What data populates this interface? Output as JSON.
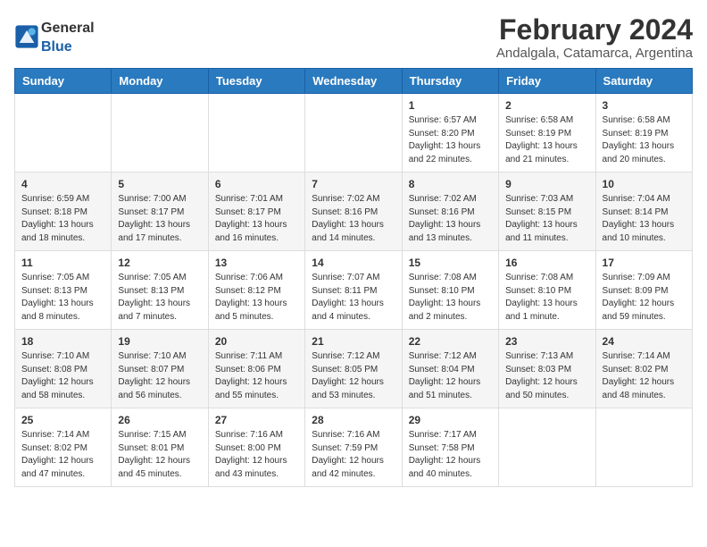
{
  "header": {
    "logo_general": "General",
    "logo_blue": "Blue",
    "title": "February 2024",
    "subtitle": "Andalgala, Catamarca, Argentina"
  },
  "calendar": {
    "days_of_week": [
      "Sunday",
      "Monday",
      "Tuesday",
      "Wednesday",
      "Thursday",
      "Friday",
      "Saturday"
    ],
    "weeks": [
      [
        {
          "day": "",
          "info": ""
        },
        {
          "day": "",
          "info": ""
        },
        {
          "day": "",
          "info": ""
        },
        {
          "day": "",
          "info": ""
        },
        {
          "day": "1",
          "info": "Sunrise: 6:57 AM\nSunset: 8:20 PM\nDaylight: 13 hours\nand 22 minutes."
        },
        {
          "day": "2",
          "info": "Sunrise: 6:58 AM\nSunset: 8:19 PM\nDaylight: 13 hours\nand 21 minutes."
        },
        {
          "day": "3",
          "info": "Sunrise: 6:58 AM\nSunset: 8:19 PM\nDaylight: 13 hours\nand 20 minutes."
        }
      ],
      [
        {
          "day": "4",
          "info": "Sunrise: 6:59 AM\nSunset: 8:18 PM\nDaylight: 13 hours\nand 18 minutes."
        },
        {
          "day": "5",
          "info": "Sunrise: 7:00 AM\nSunset: 8:17 PM\nDaylight: 13 hours\nand 17 minutes."
        },
        {
          "day": "6",
          "info": "Sunrise: 7:01 AM\nSunset: 8:17 PM\nDaylight: 13 hours\nand 16 minutes."
        },
        {
          "day": "7",
          "info": "Sunrise: 7:02 AM\nSunset: 8:16 PM\nDaylight: 13 hours\nand 14 minutes."
        },
        {
          "day": "8",
          "info": "Sunrise: 7:02 AM\nSunset: 8:16 PM\nDaylight: 13 hours\nand 13 minutes."
        },
        {
          "day": "9",
          "info": "Sunrise: 7:03 AM\nSunset: 8:15 PM\nDaylight: 13 hours\nand 11 minutes."
        },
        {
          "day": "10",
          "info": "Sunrise: 7:04 AM\nSunset: 8:14 PM\nDaylight: 13 hours\nand 10 minutes."
        }
      ],
      [
        {
          "day": "11",
          "info": "Sunrise: 7:05 AM\nSunset: 8:13 PM\nDaylight: 13 hours\nand 8 minutes."
        },
        {
          "day": "12",
          "info": "Sunrise: 7:05 AM\nSunset: 8:13 PM\nDaylight: 13 hours\nand 7 minutes."
        },
        {
          "day": "13",
          "info": "Sunrise: 7:06 AM\nSunset: 8:12 PM\nDaylight: 13 hours\nand 5 minutes."
        },
        {
          "day": "14",
          "info": "Sunrise: 7:07 AM\nSunset: 8:11 PM\nDaylight: 13 hours\nand 4 minutes."
        },
        {
          "day": "15",
          "info": "Sunrise: 7:08 AM\nSunset: 8:10 PM\nDaylight: 13 hours\nand 2 minutes."
        },
        {
          "day": "16",
          "info": "Sunrise: 7:08 AM\nSunset: 8:10 PM\nDaylight: 13 hours\nand 1 minute."
        },
        {
          "day": "17",
          "info": "Sunrise: 7:09 AM\nSunset: 8:09 PM\nDaylight: 12 hours\nand 59 minutes."
        }
      ],
      [
        {
          "day": "18",
          "info": "Sunrise: 7:10 AM\nSunset: 8:08 PM\nDaylight: 12 hours\nand 58 minutes."
        },
        {
          "day": "19",
          "info": "Sunrise: 7:10 AM\nSunset: 8:07 PM\nDaylight: 12 hours\nand 56 minutes."
        },
        {
          "day": "20",
          "info": "Sunrise: 7:11 AM\nSunset: 8:06 PM\nDaylight: 12 hours\nand 55 minutes."
        },
        {
          "day": "21",
          "info": "Sunrise: 7:12 AM\nSunset: 8:05 PM\nDaylight: 12 hours\nand 53 minutes."
        },
        {
          "day": "22",
          "info": "Sunrise: 7:12 AM\nSunset: 8:04 PM\nDaylight: 12 hours\nand 51 minutes."
        },
        {
          "day": "23",
          "info": "Sunrise: 7:13 AM\nSunset: 8:03 PM\nDaylight: 12 hours\nand 50 minutes."
        },
        {
          "day": "24",
          "info": "Sunrise: 7:14 AM\nSunset: 8:02 PM\nDaylight: 12 hours\nand 48 minutes."
        }
      ],
      [
        {
          "day": "25",
          "info": "Sunrise: 7:14 AM\nSunset: 8:02 PM\nDaylight: 12 hours\nand 47 minutes."
        },
        {
          "day": "26",
          "info": "Sunrise: 7:15 AM\nSunset: 8:01 PM\nDaylight: 12 hours\nand 45 minutes."
        },
        {
          "day": "27",
          "info": "Sunrise: 7:16 AM\nSunset: 8:00 PM\nDaylight: 12 hours\nand 43 minutes."
        },
        {
          "day": "28",
          "info": "Sunrise: 7:16 AM\nSunset: 7:59 PM\nDaylight: 12 hours\nand 42 minutes."
        },
        {
          "day": "29",
          "info": "Sunrise: 7:17 AM\nSunset: 7:58 PM\nDaylight: 12 hours\nand 40 minutes."
        },
        {
          "day": "",
          "info": ""
        },
        {
          "day": "",
          "info": ""
        }
      ]
    ]
  }
}
